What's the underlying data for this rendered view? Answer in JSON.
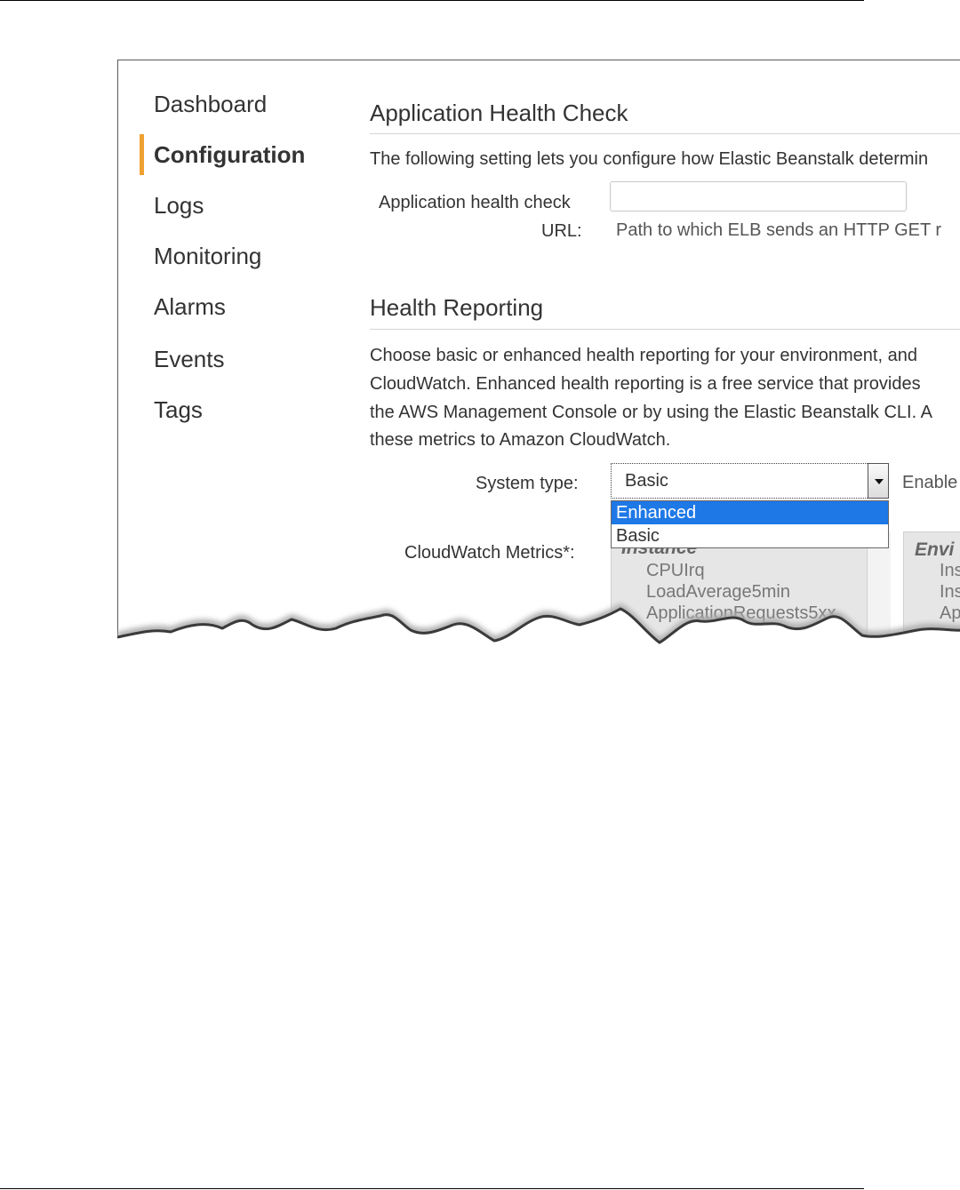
{
  "nav": {
    "items": [
      {
        "label": "Dashboard"
      },
      {
        "label": "Configuration"
      },
      {
        "label": "Logs"
      },
      {
        "label": "Monitoring"
      },
      {
        "label": "Alarms"
      },
      {
        "label": "Events"
      },
      {
        "label": "Tags"
      }
    ],
    "active_index": 1,
    "accent_color": "#f0a030"
  },
  "health_check": {
    "title": "Application Health Check",
    "description": "The following setting lets you configure how Elastic Beanstalk determin",
    "url_label_line1": "Application health check",
    "url_label_line2": "URL:",
    "url_value": "",
    "url_hint": "Path to which ELB sends an HTTP GET r"
  },
  "health_reporting": {
    "title": "Health Reporting",
    "paragraph": [
      "Choose basic or enhanced health reporting for your environment, and",
      "CloudWatch. Enhanced health reporting is a free service that provides",
      "the AWS Management Console or by using the Elastic Beanstalk CLI. A",
      "these metrics to Amazon CloudWatch."
    ],
    "system_type_label": "System type:",
    "system_type_value": "Basic",
    "system_type_options": [
      "Enhanced",
      "Basic"
    ],
    "highlighted_option": "Enhanced",
    "enable_text": "Enable",
    "cloudwatch_label": "CloudWatch Metrics*:",
    "instance_group": {
      "header": "Instance",
      "metrics": [
        "CPUIrq",
        "LoadAverage5min",
        "ApplicationRequests5xx"
      ]
    },
    "environment_group": {
      "header": "Envi",
      "metrics": [
        "Ins",
        "Ins",
        "Ap"
      ]
    }
  },
  "colors": {
    "selection": "#1e78e6"
  }
}
